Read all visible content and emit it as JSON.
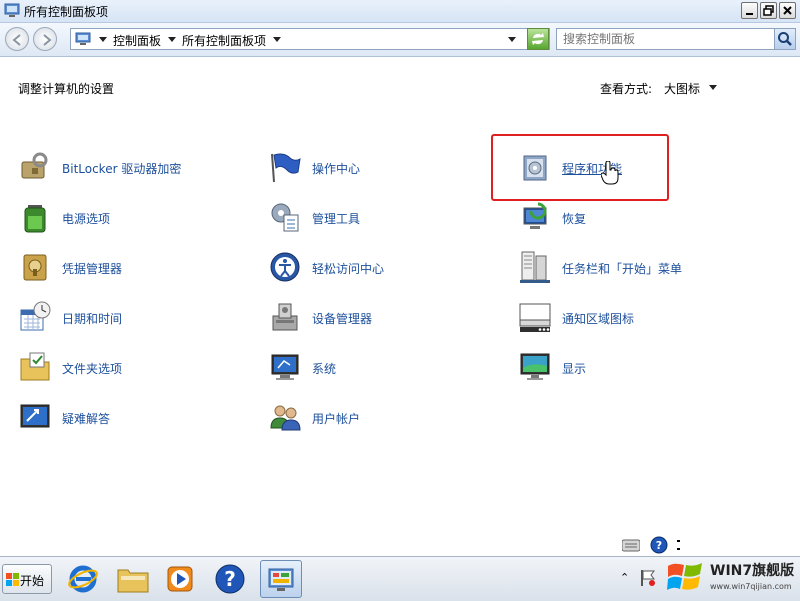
{
  "window": {
    "title": "所有控制面板项"
  },
  "address": {
    "breadcrumbs": [
      "控制面板",
      "所有控制面板项"
    ]
  },
  "search": {
    "placeholder": "搜索控制面板"
  },
  "content": {
    "heading": "调整计算机的设置",
    "view_by_label": "查看方式:",
    "view_by_value": "大图标"
  },
  "items": [
    {
      "label": "BitLocker 驱动器加密",
      "icon": "bitlocker-icon"
    },
    {
      "label": "操作中心",
      "icon": "action-center-flag-icon"
    },
    {
      "label": "程序和功能",
      "icon": "programs-features-icon",
      "highlighted": true
    },
    {
      "label": "电源选项",
      "icon": "power-battery-icon"
    },
    {
      "label": "管理工具",
      "icon": "admin-tools-icon"
    },
    {
      "label": "恢复",
      "icon": "recovery-icon"
    },
    {
      "label": "凭据管理器",
      "icon": "credential-manager-icon"
    },
    {
      "label": "轻松访问中心",
      "icon": "ease-of-access-icon"
    },
    {
      "label": "任务栏和「开始」菜单",
      "icon": "taskbar-start-icon"
    },
    {
      "label": "日期和时间",
      "icon": "date-time-icon"
    },
    {
      "label": "设备管理器",
      "icon": "device-manager-icon"
    },
    {
      "label": "通知区域图标",
      "icon": "notification-icons-icon"
    },
    {
      "label": "文件夹选项",
      "icon": "folder-options-icon"
    },
    {
      "label": "系统",
      "icon": "system-icon"
    },
    {
      "label": "显示",
      "icon": "display-icon"
    },
    {
      "label": "疑难解答",
      "icon": "troubleshooting-icon"
    },
    {
      "label": "用户帐户",
      "icon": "user-accounts-icon"
    }
  ],
  "taskbar": {
    "start_label": "开始",
    "buttons": [
      "internet-explorer-icon",
      "explorer-folder-icon",
      "media-player-icon",
      "help-icon",
      "control-panel-icon"
    ]
  },
  "watermark": {
    "title": "WIN7旗舰版",
    "url": "www.win7qijian.com"
  },
  "colors": {
    "link": "#1c4f9c",
    "highlight_border": "#e02020"
  }
}
